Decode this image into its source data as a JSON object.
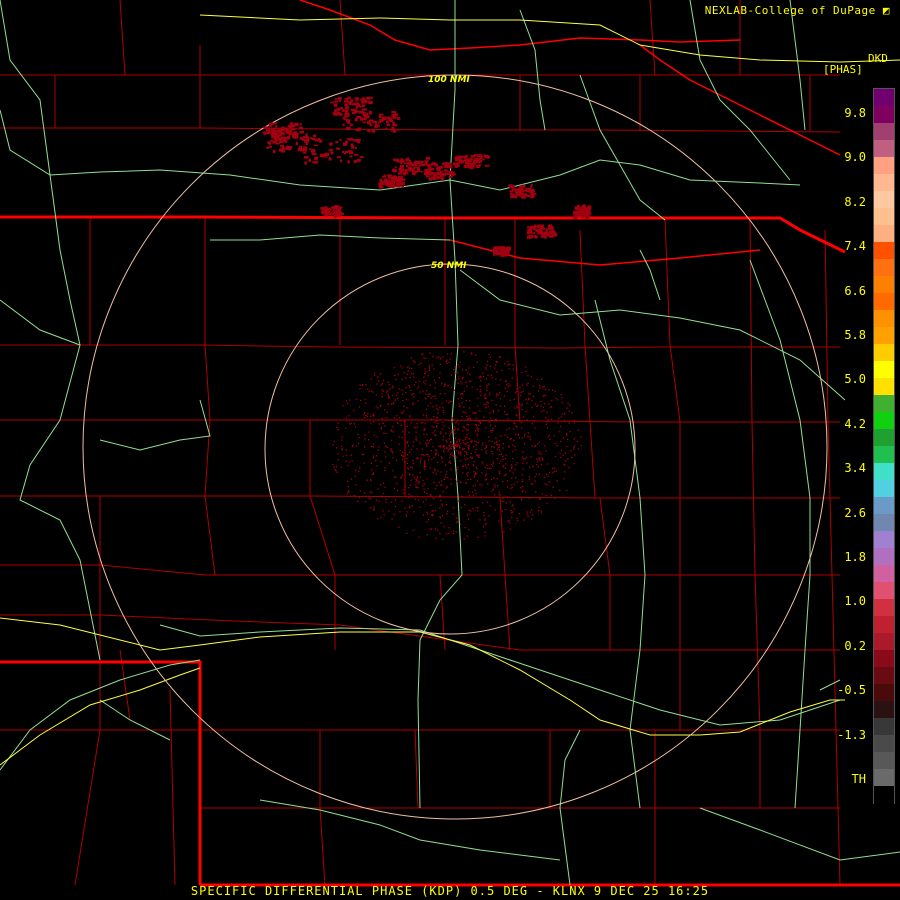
{
  "header": {
    "credit": "NEXLAB-College of DuPage",
    "product_code": "DKD",
    "units": "[PHAS]"
  },
  "footer": {
    "caption": "SPECIFIC DIFFERENTIAL PHASE (KDP) 0.5 DEG - KLNX 9 DEC 25 16:25"
  },
  "range_rings": [
    {
      "label": "100 NMI"
    },
    {
      "label": "50 NMI"
    }
  ],
  "legend": {
    "ticks": [
      "9.8",
      "9.0",
      "8.2",
      "7.4",
      "6.6",
      "5.8",
      "5.0",
      "4.2",
      "3.4",
      "2.6",
      "1.8",
      "1.0",
      "0.2",
      "-0.5",
      "-1.3",
      "TH"
    ],
    "colors": [
      "#000000",
      "#6a6a6a",
      "#585858",
      "#4a4a4a",
      "#383838",
      "#2a1212",
      "#4a0a0a",
      "#6a0a12",
      "#8a0a1a",
      "#aa1a2a",
      "#c02030",
      "#d03040",
      "#e05070",
      "#d060a0",
      "#b070c0",
      "#a080d0",
      "#7088b0",
      "#6a9ac8",
      "#50d0e0",
      "#40e0c8",
      "#20c050",
      "#20a030",
      "#10d010",
      "#40b030",
      "#ffe000",
      "#ffff00",
      "#ffcc00",
      "#ffa000",
      "#ff9000",
      "#ff6a00",
      "#ff8000",
      "#ff7010",
      "#ff5000",
      "#ffb080",
      "#ffc090",
      "#ffc8a0",
      "#ffb890",
      "#ffa080",
      "#c06080",
      "#a04070",
      "#800060",
      "#700070"
    ]
  },
  "colors": {
    "county_lines": "#b00000",
    "state_lines": "#ff0000",
    "highways": "#90e090",
    "interstates": "#ffff40",
    "range_rings": "#f0c0a0",
    "echo": "#a00010",
    "labels": "#ffff00"
  }
}
